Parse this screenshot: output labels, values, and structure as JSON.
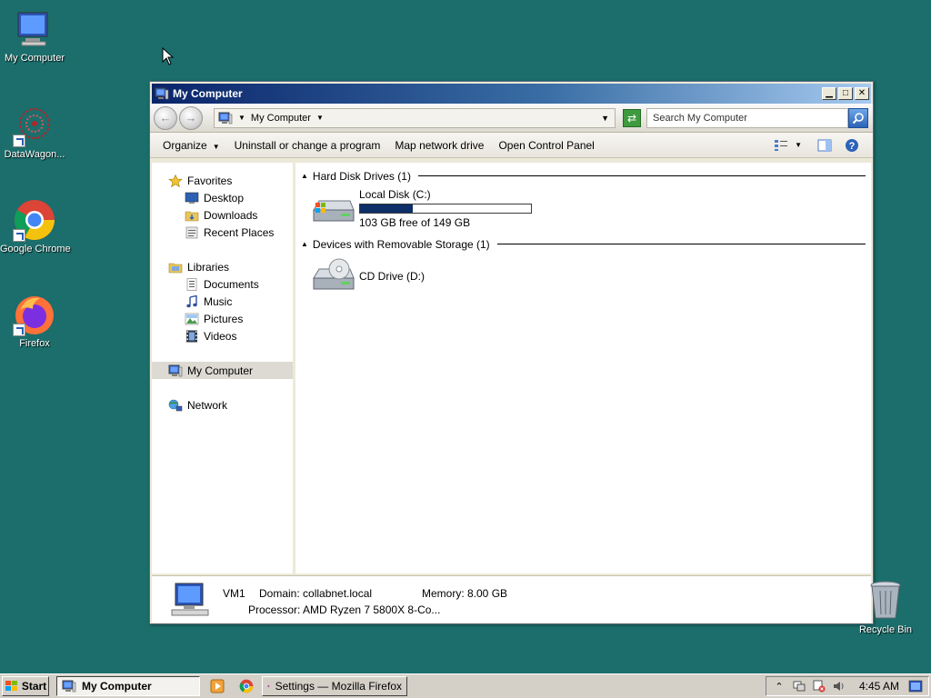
{
  "desktop": {
    "icons": [
      {
        "label": "My Computer",
        "icon": "my-computer-icon"
      },
      {
        "label": "DataWagon...",
        "icon": "datawagon-icon"
      },
      {
        "label": "Google Chrome",
        "icon": "chrome-icon"
      },
      {
        "label": "Firefox",
        "icon": "firefox-icon"
      }
    ],
    "recycle_bin": "Recycle Bin"
  },
  "window": {
    "title": "My Computer",
    "address": "My Computer",
    "search_placeholder": "Search My Computer",
    "commands": {
      "organize": "Organize",
      "uninstall": "Uninstall or change a program",
      "map_drive": "Map network drive",
      "control_panel": "Open Control Panel"
    },
    "nav": {
      "favorites": "Favorites",
      "desktop": "Desktop",
      "downloads": "Downloads",
      "recent": "Recent Places",
      "libraries": "Libraries",
      "documents": "Documents",
      "music": "Music",
      "pictures": "Pictures",
      "videos": "Videos",
      "my_computer": "My Computer",
      "network": "Network"
    },
    "groups": {
      "hdd": "Hard Disk Drives (1)",
      "removable": "Devices with Removable Storage (1)"
    },
    "drives": {
      "local": {
        "name": "Local Disk (C:)",
        "free": "103 GB free of 149 GB",
        "used_fraction": 0.31
      },
      "cd": {
        "name": "CD Drive (D:)"
      }
    },
    "details": {
      "name": "VM1",
      "domain": "Domain: collabnet.local",
      "memory": "Memory: 8.00 GB",
      "processor": "Processor: AMD Ryzen 7 5800X 8-Co..."
    }
  },
  "taskbar": {
    "start": "Start",
    "active_task": "My Computer",
    "firefox_task": "Settings — Mozilla Firefox",
    "clock": "4:45 AM"
  },
  "colors": {
    "desktop": "#1b6e6b",
    "title_start": "#0a246a",
    "capacity_fill": "#0e2f68"
  }
}
